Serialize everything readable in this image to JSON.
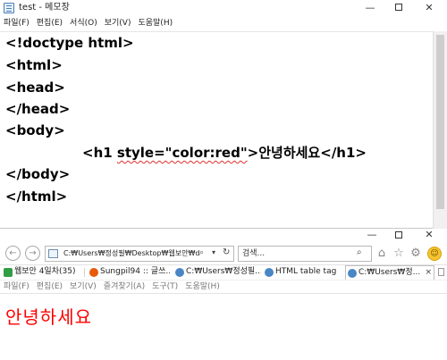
{
  "notepad": {
    "title": "test - 메모장",
    "menu": [
      "파일(F)",
      "편집(E)",
      "서식(O)",
      "보기(V)",
      "도움말(H)"
    ],
    "lines": [
      "<!doctype html>",
      "<html>",
      "<head>",
      "</head>",
      "<body>",
      "",
      "</body>",
      "</html>"
    ],
    "h1_line": {
      "indent": "            ",
      "open": "<h1 ",
      "attr": "style=\"color:red\"",
      "close_bracket": ">",
      "text": "안녕하세요",
      "end": "</h1>"
    }
  },
  "ie": {
    "address": "C:₩Users₩정성필₩Desktop₩웹보안₩da",
    "search_placeholder": "검색...",
    "tabs": [
      {
        "label": "웹보안 4일차(35)",
        "icon_color": "#2f9e44"
      },
      {
        "label": "Sungpil94 :: 글쓰...",
        "icon_color": "#e8590c"
      },
      {
        "label": "C:₩Users₩정성필...",
        "icon_color": "#4a86c5"
      },
      {
        "label": "HTML table tag",
        "icon_color": "#4a86c5"
      },
      {
        "label": "C:₩Users₩정...",
        "icon_color": "#4a86c5"
      }
    ],
    "menu": [
      "파일(F)",
      "편집(E)",
      "보기(V)",
      "즐겨찾기(A)",
      "도구(T)",
      "도움말(H)"
    ],
    "page_heading": "안녕하세요",
    "page_heading_color": "#ff0000"
  },
  "icons": {
    "minimize": "—",
    "close": "✕",
    "back": "←",
    "forward": "→",
    "search": "⌕",
    "dropdown": "▾",
    "refresh": "↻",
    "home": "⌂",
    "star": "☆",
    "gear": "⚙",
    "smile": "☺",
    "tab_close": "×"
  }
}
